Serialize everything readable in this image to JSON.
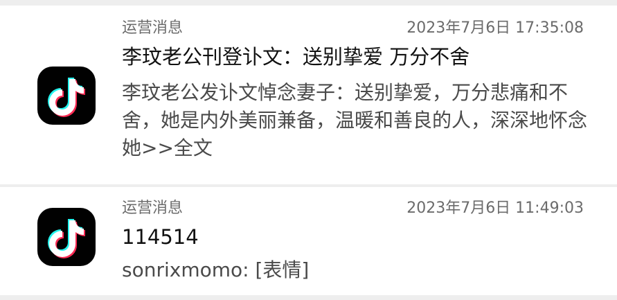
{
  "notifications": [
    {
      "app_icon": "tiktok-icon",
      "source": "运营消息",
      "time": "2023年7月6日 17:35:08",
      "title": "李玟老公刊登讣文：送别挚爱 万分不舍",
      "body": "李玟老公发讣文悼念妻子：送别挚爱，万分悲痛和不舍，她是内外美丽兼备，温暖和善良的人，深深地怀念她>>全文"
    },
    {
      "app_icon": "tiktok-icon",
      "source": "运营消息",
      "time": "2023年7月6日 11:49:03",
      "title": "114514",
      "body": "sonrixmomo: [表情]"
    }
  ],
  "colors": {
    "background": "#eeeeee",
    "card": "#ffffff",
    "icon_bg": "#010101",
    "icon_cyan": "#25f4ee",
    "icon_red": "#fe2c55"
  }
}
